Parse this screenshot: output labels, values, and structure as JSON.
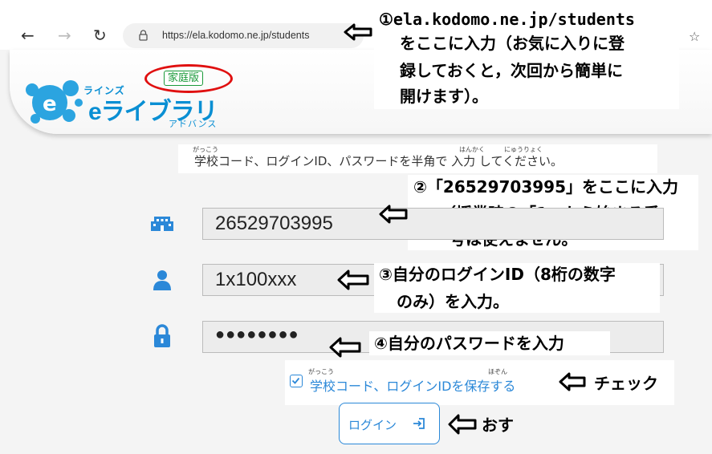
{
  "browser": {
    "url": "https://ela.kodomo.ne.jp/students",
    "back_glyph": "←",
    "forward_glyph": "→",
    "reload_glyph": "↻"
  },
  "header": {
    "logo_small": "ラインズ",
    "logo_main": "eライブラリ",
    "logo_sub": "アドバンス",
    "edition_badge": "家庭版"
  },
  "instruction": {
    "text": "学校コード、ログインID、パスワードを半角で 入力 してください。",
    "ruby": [
      {
        "reading": "がっこう"
      },
      {
        "reading": "はんかく"
      },
      {
        "reading": "にゅうりょく"
      }
    ]
  },
  "fields": {
    "school_code": "26529703995",
    "login_id": "1x100xxx",
    "password": "●●●●●●●●"
  },
  "save_option": {
    "label": "学校コード、ログインIDを保存する",
    "ruby_gakkou": "がっこう",
    "ruby_hozon": "ほぞん",
    "checked": true
  },
  "login_button": {
    "label": "ログイン"
  },
  "annotations": {
    "a1_line1": "①ela.kodomo.ne.jp/students",
    "a1_line2": "をここに入力（お気に入りに登",
    "a1_line3": "録しておくと，次回から簡単に",
    "a1_line4": "開けます）。",
    "a2_line1": "②「26529703995」をここに入力",
    "a2_line2": "（授業時の「1」から始まる番",
    "a2_line3": "号は使えません。",
    "a3_line1": "③自分のログインID（8桁の数字",
    "a3_line2": "のみ）を入力。",
    "a4": "④自分のパスワードを入力",
    "a5": "チェック",
    "a6": "おす"
  },
  "colors": {
    "accent_blue": "#2b88d8",
    "logo_blue": "#0a8fd3",
    "ring_red": "#e01010",
    "badge_green": "#1a9a3a"
  }
}
